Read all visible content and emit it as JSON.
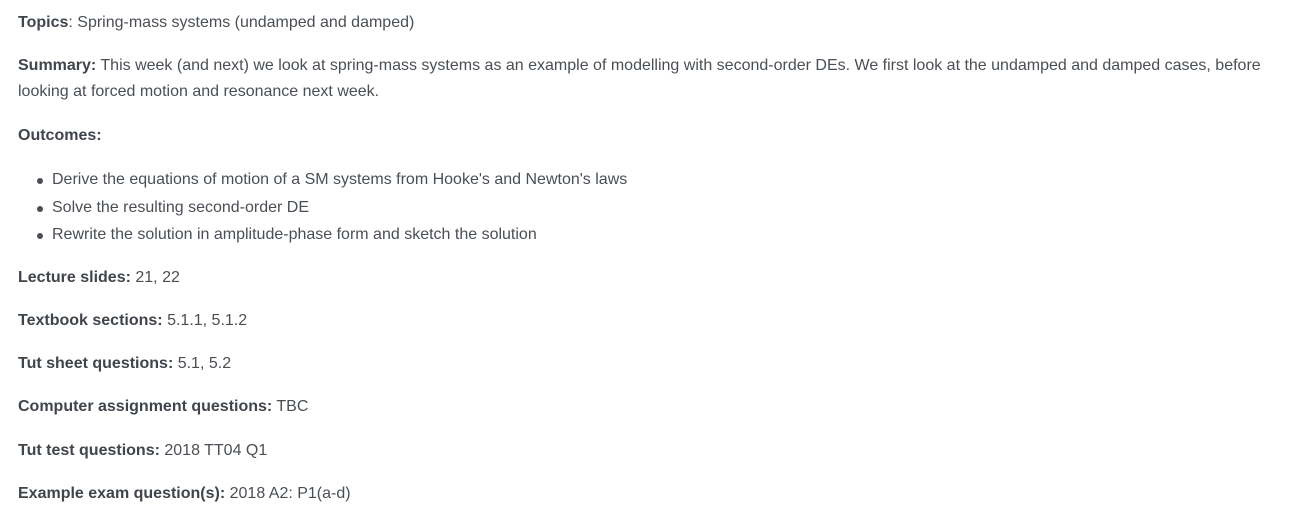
{
  "topics": {
    "label": "Topics",
    "value": ": Spring-mass systems (undamped and damped)"
  },
  "summary": {
    "label": "Summary:",
    "value": " This week (and next) we look at spring-mass systems as an example of modelling with second-order DEs. We first look at the undamped and damped cases, before looking at forced motion and resonance next week."
  },
  "outcomes": {
    "label": "Outcomes:",
    "items": [
      "Derive the equations of motion of a SM systems from Hooke's and Newton's laws",
      "Solve the resulting second-order DE",
      "Rewrite the solution in amplitude-phase form and sketch the solution"
    ]
  },
  "details": [
    {
      "label": "Lecture slides:",
      "value": " 21, 22"
    },
    {
      "label": "Textbook sections:",
      "value": " 5.1.1, 5.1.2"
    },
    {
      "label": "Tut sheet questions:",
      "value": " 5.1, 5.2"
    },
    {
      "label": "Computer assignment questions:",
      "value": " TBC"
    },
    {
      "label": "Tut test questions:",
      "value": " 2018 TT04 Q1"
    },
    {
      "label": "Example exam question(s):",
      "value": " 2018 A2: P1(a-d)"
    }
  ]
}
